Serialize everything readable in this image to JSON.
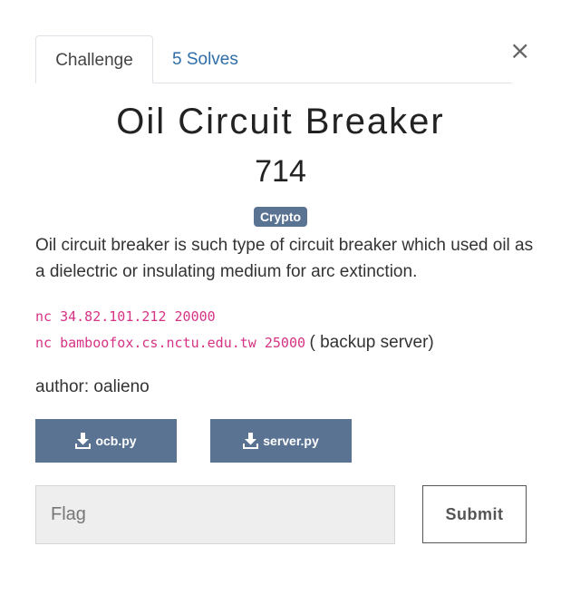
{
  "tabs": [
    {
      "label": "Challenge",
      "active": true
    },
    {
      "label": "5 Solves",
      "active": false
    }
  ],
  "close_label": "×",
  "challenge": {
    "title": "Oil Circuit Breaker",
    "value": "714",
    "category": "Crypto",
    "description": "Oil circuit breaker is such type of circuit breaker which used oil as a dielectric or insulating medium for arc extinction.",
    "connections": [
      {
        "command": "nc 34.82.101.212 20000",
        "note": ""
      },
      {
        "command": "nc bamboofox.cs.nctu.edu.tw 25000",
        "note": "( backup server)"
      }
    ],
    "author": "author: oalieno"
  },
  "files": [
    {
      "name": "ocb.py",
      "icon": "download-icon"
    },
    {
      "name": "server.py",
      "icon": "download-icon"
    }
  ],
  "flag_input": {
    "placeholder": "Flag",
    "value": ""
  },
  "submit_label": "Submit",
  "colors": {
    "accent": "#5b7393",
    "link": "#2e6ea8",
    "code": "#d63384"
  }
}
